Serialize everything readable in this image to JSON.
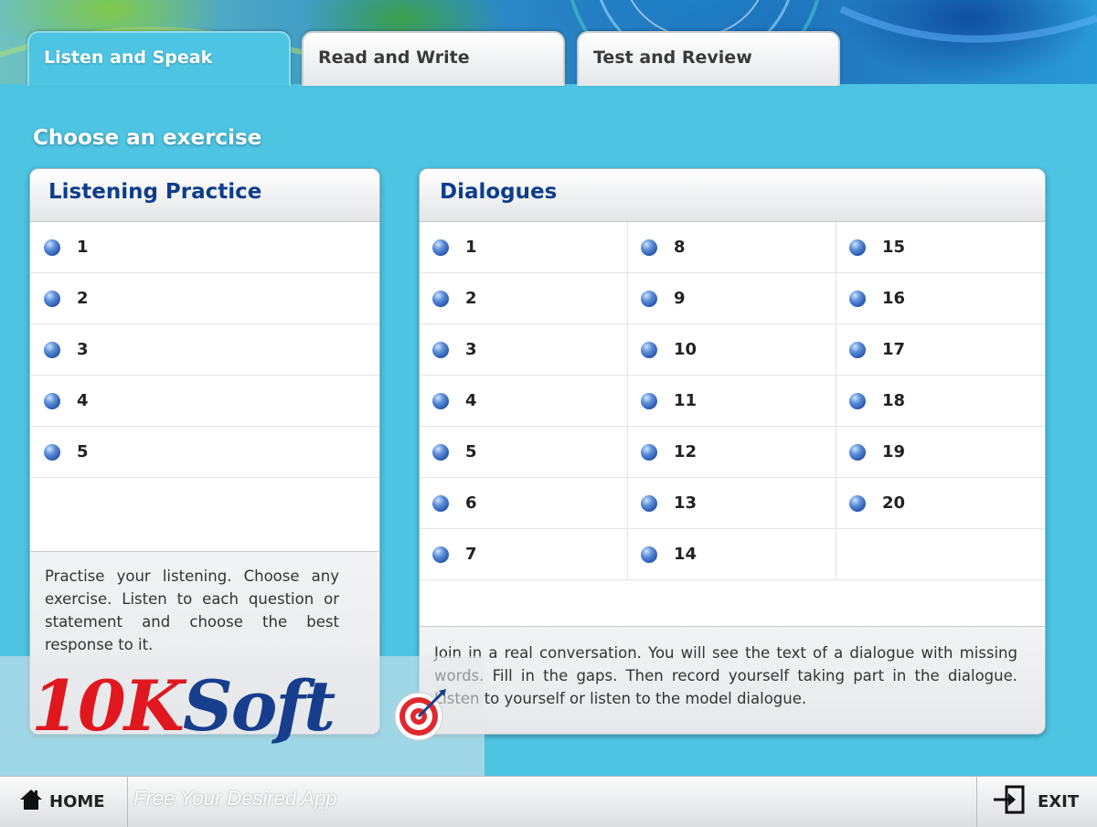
{
  "tabs": [
    {
      "label": "Listen and Speak",
      "active": true
    },
    {
      "label": "Read and Write",
      "active": false
    },
    {
      "label": "Test and Review",
      "active": false
    }
  ],
  "heading": "Choose an exercise",
  "listening": {
    "title": "Listening Practice",
    "items": [
      "1",
      "2",
      "3",
      "4",
      "5"
    ],
    "description": "Practise your listening. Choose any exercise. Listen to each question or statement and choose the best response to it."
  },
  "dialogues": {
    "title": "Dialogues",
    "columns": [
      [
        "1",
        "2",
        "3",
        "4",
        "5",
        "6",
        "7"
      ],
      [
        "8",
        "9",
        "10",
        "11",
        "12",
        "13",
        "14"
      ],
      [
        "15",
        "16",
        "17",
        "18",
        "19",
        "20"
      ]
    ],
    "description": "Join in a real conversation. You will see the text of a dialogue with missing words. Fill in the gaps. Then record yourself taking part in the dialogue. Listen to yourself or listen to the model dialogue."
  },
  "watermark": {
    "logo_part1": "10K",
    "logo_part2": "Soft",
    "tagline": "Free Your Desired App",
    "target_icon": "target-icon"
  },
  "bottombar": {
    "home_label": "HOME",
    "home_icon": "home-icon",
    "exit_label": "EXIT",
    "exit_icon": "exit-icon"
  },
  "colors": {
    "background": "#4cc4e2",
    "panel_title": "#0e3d8c",
    "bullet": "#1f4fa8"
  }
}
